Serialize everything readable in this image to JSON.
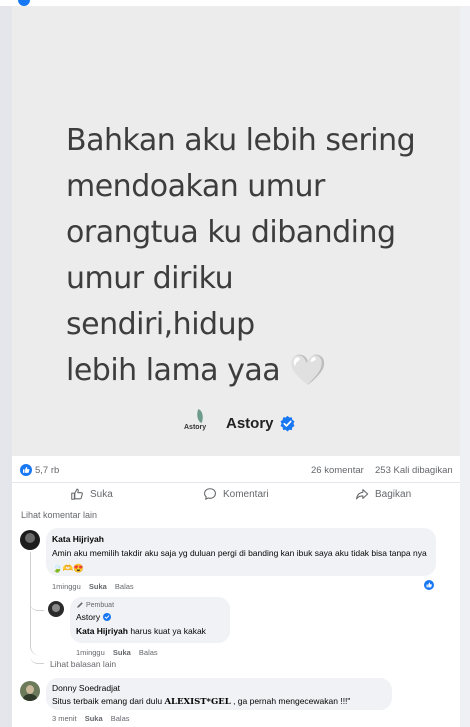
{
  "post": {
    "quote_lines": [
      "Bahkan aku lebih sering",
      "mendoakan umur",
      "orangtua ku dibanding",
      "umur diriku sendiri,hidup",
      "lebih lama yaa 🤍"
    ],
    "brand_logo_text": "Astory",
    "brand_name": "Astory"
  },
  "stats": {
    "likes": "5,7 rb",
    "comments": "26 komentar",
    "shares": "253 Kali dibagikan"
  },
  "actions": {
    "like": "Suka",
    "comment": "Komentari",
    "share": "Bagikan"
  },
  "comments_section": {
    "more_comments": "Lihat komentar lain",
    "comment1": {
      "author": "Kata Hijriyah",
      "text": "Amin aku memilih takdir aku saja yg duluan pergi di banding kan ibuk saya aku tidak bisa tanpa nya🍃🫶😍",
      "time": "1minggu",
      "like": "Suka",
      "reply": "Balas"
    },
    "reply1": {
      "badge": "Pembuat",
      "author": "Astory",
      "mention": "Kata Hijriyah",
      "text": " harus kuat ya kakak",
      "time": "1minggu",
      "like": "Suka",
      "reply": "Balas"
    },
    "more_replies": "Lihat balasan lain",
    "comment2": {
      "author": "Donny Soedradjat",
      "text_prefix": "Situs terbaik emang dari dulu ",
      "text_bold": "ALEXIST*GEL",
      "text_suffix": " , ga pernah mengecewakan !!!\"",
      "time": "3 menit",
      "like": "Suka",
      "reply": "Balas"
    }
  },
  "colors": {
    "facebook_blue": "#1877f2",
    "photo_bg": "#ececec",
    "bubble_bg": "#f0f2f5"
  }
}
